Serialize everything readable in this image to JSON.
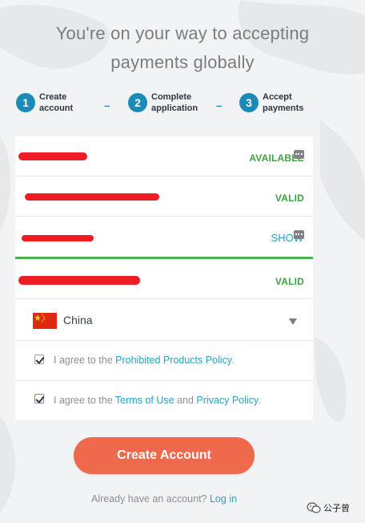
{
  "header": {
    "line1": "You're on your way to accepting",
    "line2": "payments globally"
  },
  "steps": [
    {
      "number": "1",
      "line1": "Create",
      "line2": "account"
    },
    {
      "number": "2",
      "line1": "Complete",
      "line2": "application"
    },
    {
      "number": "3",
      "line1": "Accept",
      "line2": "payments"
    }
  ],
  "step_separator": "–",
  "form": {
    "username_status": "AVAILABLE",
    "email_status": "VALID",
    "password_toggle": "SHOW",
    "confirm_status": "VALID",
    "country": "China",
    "agree_prefix": "I agree to the",
    "prohibited_policy": "Prohibited Products Policy",
    "terms_of_use": "Terms of Use",
    "and": "and",
    "privacy_policy": "Privacy Policy",
    "period": ".",
    "check1_checked": true,
    "check2_checked": true
  },
  "create_button": "Create Account",
  "login": {
    "prompt": "Already have an account?",
    "link": "Log in"
  },
  "watermark": {
    "text": "公子曾"
  },
  "colors": {
    "primary_blue": "#1a8bb6",
    "valid_green": "#3fa142",
    "cta_orange": "#ef6a4d",
    "link_blue": "#2aa1c3"
  }
}
